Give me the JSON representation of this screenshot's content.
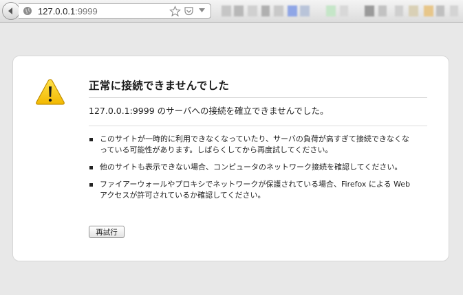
{
  "toolbar": {
    "url_host": "127.0.0.1",
    "url_port": ":9999"
  },
  "error": {
    "title": "正常に接続できませんでした",
    "description": "127.0.0.1:9999 のサーバへの接続を確立できませんでした。",
    "suggestions": [
      "このサイトが一時的に利用できなくなっていたり、サーバの負荷が高すぎて接続できなくなっている可能性があります。しばらくしてから再度試してください。",
      "他のサイトも表示できない場合、コンピュータのネットワーク接続を確認してください。",
      "ファイアーウォールやプロキシでネットワークが保護されている場合、Firefox による Web アクセスが許可されているか確認してください。"
    ],
    "retry_label": "再試行"
  },
  "colors": {
    "page_background": "#e8e8e8",
    "card_background": "#ffffff",
    "warning_yellow": "#f5c400"
  },
  "icons": [
    "back-arrow-icon",
    "globe-icon",
    "bookmark-star-icon",
    "pocket-icon",
    "dropmarker-icon",
    "warning-icon"
  ]
}
